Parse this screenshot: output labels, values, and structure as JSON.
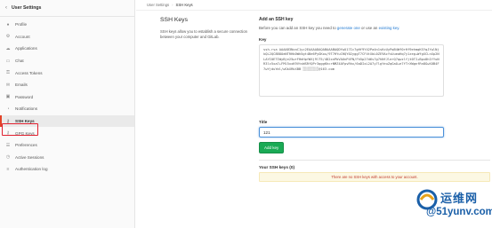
{
  "sidebar": {
    "header": {
      "back_icon": "arrow-left-icon",
      "title": "User Settings"
    },
    "items": [
      {
        "label": "Profile",
        "icon": "user-icon",
        "glyph": "●"
      },
      {
        "label": "Account",
        "icon": "gear-icon",
        "glyph": "⚙"
      },
      {
        "label": "Applications",
        "icon": "cloud-icon",
        "glyph": "☁"
      },
      {
        "label": "Chat",
        "icon": "comment-icon",
        "glyph": "▭"
      },
      {
        "label": "Access Tokens",
        "icon": "key-icon",
        "glyph": "⚿"
      },
      {
        "label": "Emails",
        "icon": "envelope-icon",
        "glyph": "✉"
      },
      {
        "label": "Password",
        "icon": "lock-icon",
        "glyph": "▣"
      },
      {
        "label": "Notifications",
        "icon": "bell-icon",
        "glyph": "◔"
      },
      {
        "label": "SSH Keys",
        "icon": "key-icon",
        "glyph": "⚷",
        "active": true
      },
      {
        "label": "GPG Keys",
        "icon": "key-icon",
        "glyph": "⚷"
      },
      {
        "label": "Preferences",
        "icon": "sliders-icon",
        "glyph": "☰"
      },
      {
        "label": "Active Sessions",
        "icon": "history-icon",
        "glyph": "◷"
      },
      {
        "label": "Authentication log",
        "icon": "list-icon",
        "glyph": "≡"
      }
    ]
  },
  "breadcrumb": {
    "parent": "User Settings",
    "separator": "›",
    "current": "SSH Keys"
  },
  "left": {
    "title": "SSH Keys",
    "description": "SSH keys allow you to establish a secure connection between your computer and GitLab."
  },
  "form": {
    "heading": "Add an SSH key",
    "intro_prefix": "Before you can add an SSH key you need to",
    "intro_link1": "generate one",
    "intro_middle": "or use an",
    "intro_link2": "existing key.",
    "key_label": "Key",
    "key_value": "ssh-rsa AAAAB3NzaC1yc2EAAAADAQABAAABAQDYwU17Ic7gHf9Y42Pa4n1sKcUyPqB4Wf0rHf9ehmqKSYqJYwlNjkQL2QC8B8OeNTRHk0Wh5gt4Be6PyGKou/9T7HYuCHQY02yggT7CF4tXbL0ZE9AcYsUueaHq7y1zeg+WfgXCLnXp2NLAYI0ETIWyBje25wrFHeHpfWXj9lT5/4D2xnPbVAUnP4FN/Fh5p27d6s7g7hNfJlerQ7qwzlfjt0TI+Bpx8hIfYuNR3lc5xa7+FMl5xxK9VtvWSRfQPr3qggKhcrNMZ4AFpvRhx/6aDIxL2A7y7lgYeuZqGaO+e7fTrXWgnfRn8GwXUB4F7wYjduYml/wGkXRkXBB",
    "key_suffix": "░░░░░░░░@163.com",
    "title_label": "Title",
    "title_value": "121",
    "add_button": "Add key"
  },
  "keys": {
    "heading": "Your SSH keys (0)",
    "empty_message": "There are no SSH keys with access to your account."
  },
  "watermark": {
    "line1": "运维网",
    "line2": "@51yunv.com"
  },
  "colors": {
    "accent": "#1f78d1",
    "success": "#1aaa55",
    "active_bar": "#e24329",
    "highlight": "#e0202f"
  }
}
